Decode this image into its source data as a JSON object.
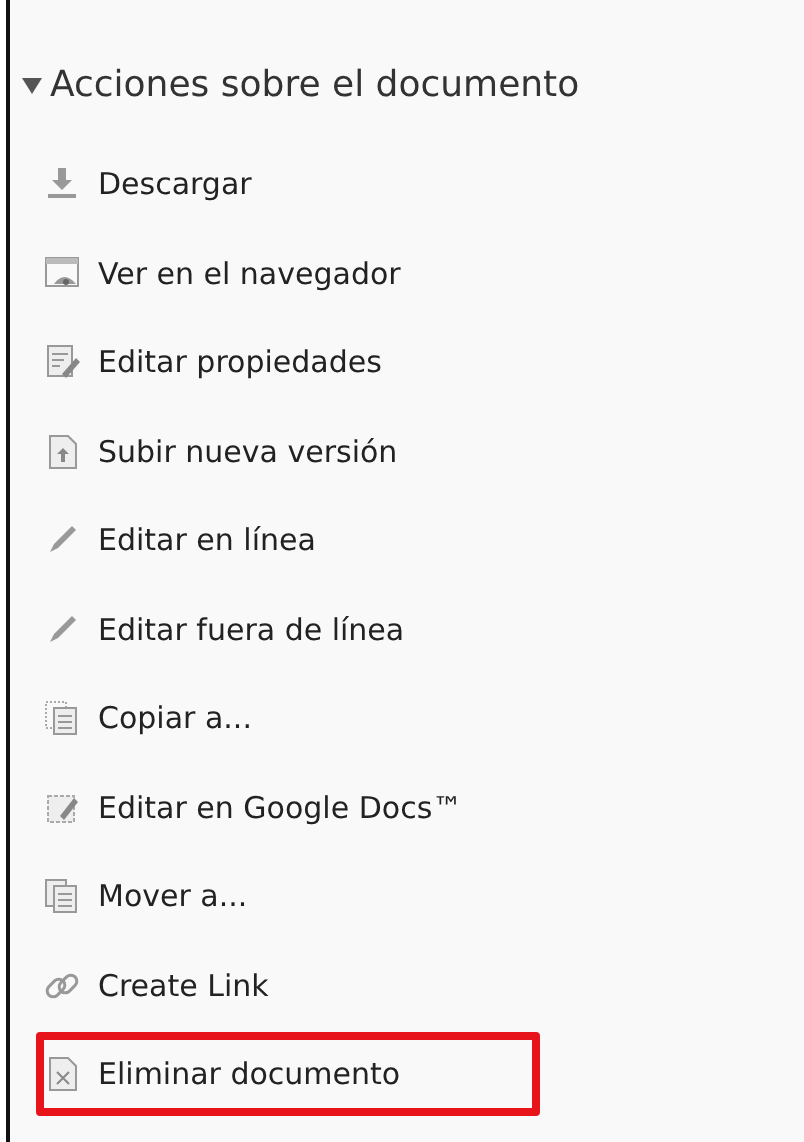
{
  "section": {
    "title": "Acciones sobre el documento",
    "expanded": true,
    "items": [
      {
        "kind": "download",
        "label": "Descargar",
        "highlighted": false
      },
      {
        "kind": "view",
        "label": "Ver en el navegador",
        "highlighted": false
      },
      {
        "kind": "properties",
        "label": "Editar propiedades",
        "highlighted": false
      },
      {
        "kind": "upload",
        "label": "Subir nueva versión",
        "highlighted": false
      },
      {
        "kind": "pencil",
        "label": "Editar en línea",
        "highlighted": false
      },
      {
        "kind": "pencil",
        "label": "Editar fuera de línea",
        "highlighted": false
      },
      {
        "kind": "copy",
        "label": "Copiar a...",
        "highlighted": false
      },
      {
        "kind": "edit",
        "label": "Editar en Google Docs™",
        "highlighted": false
      },
      {
        "kind": "move",
        "label": "Mover a...",
        "highlighted": false
      },
      {
        "kind": "link",
        "label": "Create Link",
        "highlighted": false
      },
      {
        "kind": "delete",
        "label": "Eliminar documento",
        "highlighted": true
      }
    ]
  }
}
